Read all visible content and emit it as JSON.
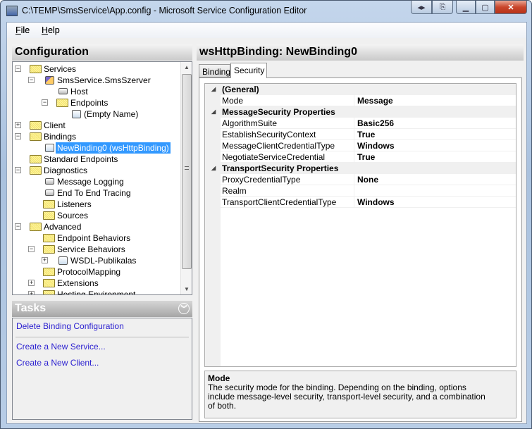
{
  "window": {
    "title": "C:\\TEMP\\SmsService\\App.config - Microsoft Service Configuration Editor",
    "buttons": [
      "restore-panes",
      "switch",
      "minimize",
      "maximize",
      "close"
    ]
  },
  "menu": [
    {
      "label": "File",
      "key": "F",
      "rest": "ile"
    },
    {
      "label": "Help",
      "key": "H",
      "rest": "elp"
    }
  ],
  "left": {
    "header": "Configuration",
    "tree": [
      {
        "label": "Services",
        "level": 0,
        "exp": "-",
        "icon": "folder"
      },
      {
        "label": "SmsService.SmsSzerver",
        "level": 1,
        "exp": "-",
        "icon": "service"
      },
      {
        "label": "Host",
        "level": 2,
        "exp": "",
        "icon": "node"
      },
      {
        "label": "Endpoints",
        "level": 2,
        "exp": "-",
        "icon": "folder"
      },
      {
        "label": "(Empty Name)",
        "level": 3,
        "exp": "",
        "icon": "endpoint"
      },
      {
        "label": "Client",
        "level": 0,
        "exp": "+",
        "icon": "folder"
      },
      {
        "label": "Bindings",
        "level": 0,
        "exp": "-",
        "icon": "folder"
      },
      {
        "label": "NewBinding0 (wsHttpBinding)",
        "level": 1,
        "exp": "",
        "icon": "binding",
        "selected": true
      },
      {
        "label": "Standard Endpoints",
        "level": 0,
        "exp": "",
        "icon": "folder"
      },
      {
        "label": "Diagnostics",
        "level": 0,
        "exp": "-",
        "icon": "folder"
      },
      {
        "label": "Message Logging",
        "level": 1,
        "exp": "",
        "icon": "node"
      },
      {
        "label": "End To End Tracing",
        "level": 1,
        "exp": "",
        "icon": "node"
      },
      {
        "label": "Listeners",
        "level": 1,
        "exp": "",
        "icon": "folder"
      },
      {
        "label": "Sources",
        "level": 1,
        "exp": "",
        "icon": "folder"
      },
      {
        "label": "Advanced",
        "level": 0,
        "exp": "-",
        "icon": "folder"
      },
      {
        "label": "Endpoint Behaviors",
        "level": 1,
        "exp": "",
        "icon": "folder"
      },
      {
        "label": "Service Behaviors",
        "level": 1,
        "exp": "-",
        "icon": "folder"
      },
      {
        "label": "WSDL-Publikalas",
        "level": 2,
        "exp": "+",
        "icon": "behavior"
      },
      {
        "label": "ProtocolMapping",
        "level": 1,
        "exp": "",
        "icon": "folder"
      },
      {
        "label": "Extensions",
        "level": 1,
        "exp": "+",
        "icon": "folder"
      },
      {
        "label": "Hosting Environment",
        "level": 1,
        "exp": "+",
        "icon": "folder"
      }
    ],
    "tasks_header": "Tasks",
    "tasks": [
      "Delete Binding Configuration",
      "Create a New Service...",
      "Create a New Client..."
    ]
  },
  "right": {
    "header": "wsHttpBinding: NewBinding0",
    "tabs": [
      {
        "label": "Binding",
        "active": false
      },
      {
        "label": "Security",
        "active": true
      }
    ],
    "grid": [
      {
        "category": "(General)"
      },
      {
        "name": "Mode",
        "value": "Message"
      },
      {
        "category": "MessageSecurity Properties"
      },
      {
        "name": "AlgorithmSuite",
        "value": "Basic256"
      },
      {
        "name": "EstablishSecurityContext",
        "value": "True"
      },
      {
        "name": "MessageClientCredentialType",
        "value": "Windows"
      },
      {
        "name": "NegotiateServiceCredential",
        "value": "True"
      },
      {
        "category": "TransportSecurity Properties"
      },
      {
        "name": "ProxyCredentialType",
        "value": "None"
      },
      {
        "name": "Realm",
        "value": ""
      },
      {
        "name": "TransportClientCredentialType",
        "value": "Windows"
      }
    ],
    "description": {
      "title": "Mode",
      "text": "The security mode for the binding. Depending on the binding, options include message-level security, transport-level security, and a combination of both."
    }
  },
  "colors": {
    "selection": "#3399ff",
    "link": "#2a1fd0",
    "close": "#c9462c"
  }
}
